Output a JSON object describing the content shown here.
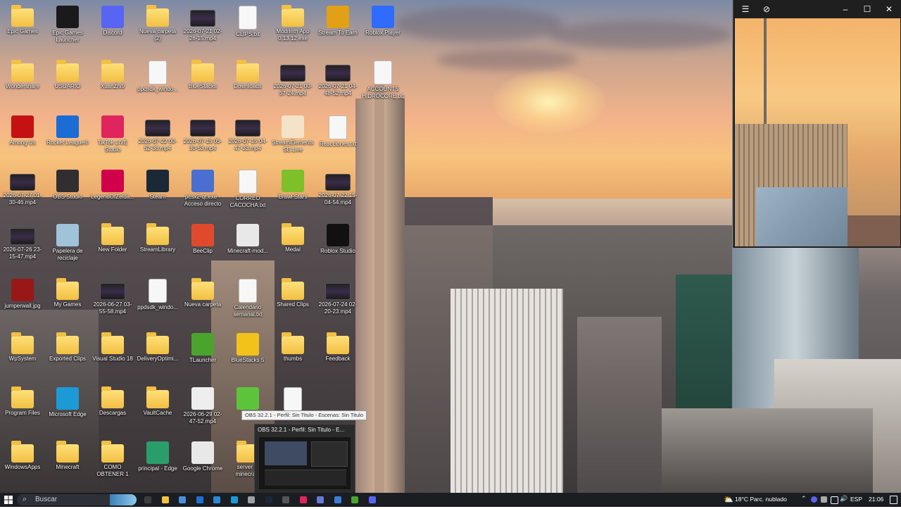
{
  "desktop": {
    "icons": [
      {
        "label": "Epic Games",
        "type": "folder"
      },
      {
        "label": "Epic Games Launcher",
        "type": "app",
        "color": "#1a1a1a"
      },
      {
        "label": "Discord",
        "type": "app",
        "color": "#5865f2"
      },
      {
        "label": "Nueva carpeta (2)",
        "type": "folder"
      },
      {
        "label": "2026-07-21 02-26-15.mp4",
        "type": "video"
      },
      {
        "label": "CLIPS.txt",
        "type": "file"
      },
      {
        "label": "Modrinth App 0.13.12.exe",
        "type": "folder"
      },
      {
        "label": "Stream To Earn",
        "type": "app",
        "color": "#e2a016"
      },
      {
        "label": "Roblox Player",
        "type": "app",
        "color": "#2f6bff"
      },
      {
        "label": "Wondershare",
        "type": "folder"
      },
      {
        "label": "USUARIO",
        "type": "folder"
      },
      {
        "label": "XuanZhi9",
        "type": "folder"
      },
      {
        "label": "ppdsdk_windo...",
        "type": "file"
      },
      {
        "label": "BlueStacks",
        "type": "folder"
      },
      {
        "label": "Downloads",
        "type": "folder"
      },
      {
        "label": "2026-07-21 00-57-24.mp4",
        "type": "video"
      },
      {
        "label": "2026-07-21 04-48-52.mp4",
        "type": "video"
      },
      {
        "label": "ACCOUNTS HIDROCORE.txt",
        "type": "file"
      },
      {
        "label": "Among Us",
        "type": "app",
        "color": "#c51111"
      },
      {
        "label": "Rocket League®",
        "type": "app",
        "color": "#1c6cd6"
      },
      {
        "label": "TikTok LIVE Studio",
        "type": "app",
        "color": "#e0245e"
      },
      {
        "label": "2026-07-22 00-52-38.mp4",
        "type": "video"
      },
      {
        "label": "2026-07-15 05-30-53.mp4",
        "type": "video"
      },
      {
        "label": "2026-07-15 04-47-33.mp4",
        "type": "video"
      },
      {
        "label": "StreamElements SE.Live",
        "type": "app",
        "color": "#f4e3c8"
      },
      {
        "label": "Reacciones.txt",
        "type": "file"
      },
      {
        "label": "2026-07-27 01-30-46.mp4",
        "type": "video"
      },
      {
        "label": "OBS Studio",
        "type": "app",
        "color": "#302e31"
      },
      {
        "label": "LegendOfZelda...",
        "type": "app",
        "color": "#d0004a"
      },
      {
        "label": "Steam",
        "type": "app",
        "color": "#1b2838"
      },
      {
        "label": "pcsx2-qt.exe - Acceso directo",
        "type": "app",
        "color": "#4a6fd1"
      },
      {
        "label": "CORREO CACOCHA.txt",
        "type": "file"
      },
      {
        "label": "Brawl Stars",
        "type": "app",
        "color": "#7dc02a"
      },
      {
        "label": "2026-07-22 15-04-54.mp4",
        "type": "video"
      },
      {
        "label": "2026-07-26 23-15-47.mp4",
        "type": "video"
      },
      {
        "label": "Papelera de reciclaje",
        "type": "app",
        "color": "#9fc3d9"
      },
      {
        "label": "New Folder",
        "type": "folder"
      },
      {
        "label": "StreamLibrary",
        "type": "folder"
      },
      {
        "label": "BeeClip",
        "type": "app",
        "color": "#e04a2c"
      },
      {
        "label": "Minecraft-mod...",
        "type": "app",
        "color": "#e8e8e8"
      },
      {
        "label": "Medal",
        "type": "folder"
      },
      {
        "label": "Roblox Studio",
        "type": "app",
        "color": "#111111"
      },
      {
        "label": "jumperwall.jpg",
        "type": "app",
        "color": "#9a1717"
      },
      {
        "label": "My Games",
        "type": "folder"
      },
      {
        "label": "2026-06-27 03-55-58.mp4",
        "type": "video"
      },
      {
        "label": "ppdsdk_windo...",
        "type": "file"
      },
      {
        "label": "Nueva carpeta",
        "type": "folder"
      },
      {
        "label": "Calendario semanal.txt",
        "type": "file"
      },
      {
        "label": "Shared Clips",
        "type": "folder"
      },
      {
        "label": "2026-07-24 02-20-23.mp4",
        "type": "video"
      },
      {
        "label": "WpSystem",
        "type": "folder"
      },
      {
        "label": "Exported Clips",
        "type": "folder"
      },
      {
        "label": "Visual Studio 18",
        "type": "folder"
      },
      {
        "label": "DeliveryOptimi...",
        "type": "folder"
      },
      {
        "label": "TLauncher",
        "type": "app",
        "color": "#4aa32c"
      },
      {
        "label": "BlueStacks 5",
        "type": "app",
        "color": "#f2c21b"
      },
      {
        "label": "thumbs",
        "type": "folder"
      },
      {
        "label": "Feedback",
        "type": "folder"
      },
      {
        "label": "Program Files",
        "type": "folder"
      },
      {
        "label": "Microsoft Edge",
        "type": "app",
        "color": "#1c9ad6"
      },
      {
        "label": "Descargas",
        "type": "folder"
      },
      {
        "label": "VaultCache",
        "type": "folder"
      },
      {
        "label": "2026-06-29 02-47-52.mp4",
        "type": "app",
        "color": "#eeeeee"
      },
      {
        "label": "",
        "type": "app",
        "color": "#5cc43a"
      },
      {
        "label": "",
        "type": "file"
      },
      {
        "label": "WindowsApps",
        "type": "folder"
      },
      {
        "label": "Minecraft",
        "type": "folder"
      },
      {
        "label": "COMO OBTENER 1",
        "type": "folder"
      },
      {
        "label": "principal - Edge",
        "type": "app",
        "color": "#2a9e6a"
      },
      {
        "label": "Google Chrome",
        "type": "app",
        "color": "#e8e8e8"
      },
      {
        "label": "server pl minecra...",
        "type": "folder"
      }
    ]
  },
  "obs_preview": {
    "tooltip": "OBS 32.2.1 - Perfil: Sin Titulo - Escenas: Sin Titulo",
    "title": "OBS 32.2.1 - Perfil: Sin Titulo - E..."
  },
  "taskbar": {
    "search_placeholder": "Buscar",
    "apps": [
      "obs-icon",
      "file-explorer-icon",
      "store-icon",
      "outlook-icon",
      "calendar-icon",
      "edge-icon",
      "notes-icon",
      "steam-icon",
      "obs-active-icon",
      "tiktok-icon",
      "app-icon",
      "shield-icon",
      "minecraft-icon",
      "discord-icon"
    ],
    "weather": "18°C  Parc. nublado",
    "language": "ESP",
    "time": "21:06"
  }
}
